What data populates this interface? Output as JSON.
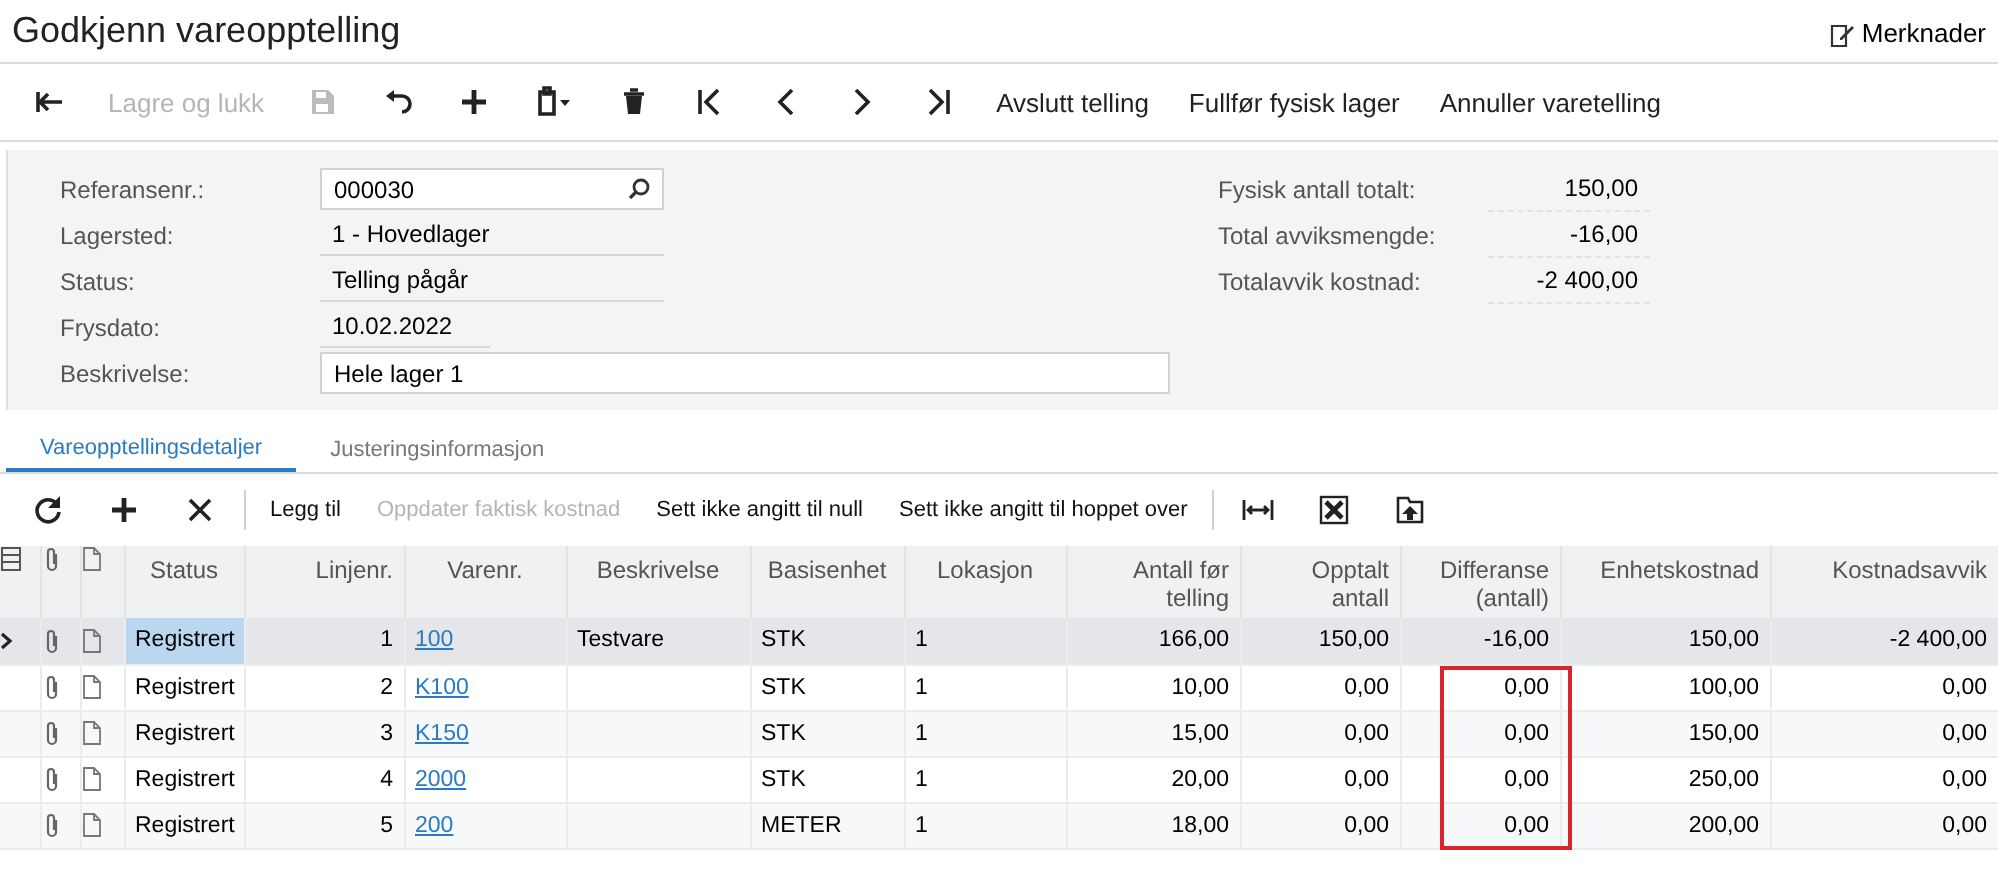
{
  "window": {
    "title": "Godkjenn vareopptelling",
    "notes_button": "Merknader"
  },
  "toolbar": [
    {
      "kind": "icon",
      "disabled": false
    },
    {
      "kind": "text",
      "label": "Lagre og lukk",
      "disabled": true
    },
    {
      "kind": "icon",
      "disabled": true
    },
    {
      "kind": "icon",
      "disabled": false
    },
    {
      "kind": "icon",
      "disabled": false
    },
    {
      "kind": "icon",
      "disabled": false
    },
    {
      "kind": "icon",
      "disabled": false
    },
    {
      "kind": "icon",
      "disabled": false
    },
    {
      "kind": "icon",
      "disabled": false
    },
    {
      "kind": "icon",
      "disabled": false
    },
    {
      "kind": "icon",
      "disabled": false
    },
    {
      "kind": "text",
      "label": "Avslutt telling",
      "disabled": false
    },
    {
      "kind": "text",
      "label": "Fullfør fysisk lager",
      "disabled": false
    },
    {
      "kind": "text",
      "label": "Annuller varetelling",
      "disabled": false
    }
  ],
  "form": {
    "left": [
      {
        "label": "Referansenr.:",
        "value": "000030",
        "kind": "lookup"
      },
      {
        "label": "Lagersted:",
        "value": "1 - Hovedlager",
        "kind": "readonly"
      },
      {
        "label": "Status:",
        "value": "Telling pågår",
        "kind": "readonly"
      },
      {
        "label": "Frysdato:",
        "value": "10.02.2022",
        "kind": "date"
      },
      {
        "label": "Beskrivelse:",
        "value": "Hele lager 1",
        "kind": "wide"
      }
    ],
    "right": [
      {
        "label": "Fysisk antall totalt:",
        "value": "150,00"
      },
      {
        "label": "Total avviksmengde:",
        "value": "-16,00"
      },
      {
        "label": "Totalavvik kostnad:",
        "value": "-2 400,00"
      }
    ]
  },
  "tabs": [
    {
      "label": "Vareopptellingsdetaljer",
      "selected": true
    },
    {
      "label": "Justeringsinformasjon",
      "selected": false
    }
  ],
  "grid_toolbar": [
    {
      "kind": "icon",
      "disabled": false
    },
    {
      "kind": "icon",
      "disabled": false
    },
    {
      "kind": "icon",
      "disabled": false
    },
    {
      "kind": "separator"
    },
    {
      "kind": "text",
      "label": "Legg til",
      "disabled": false
    },
    {
      "kind": "text",
      "label": "Oppdater faktisk kostnad",
      "disabled": true
    },
    {
      "kind": "text",
      "label": "Sett ikke angitt til null",
      "disabled": false
    },
    {
      "kind": "text",
      "label": "Sett ikke angitt til hoppet over",
      "disabled": false
    },
    {
      "kind": "separator"
    },
    {
      "kind": "icon",
      "disabled": false
    },
    {
      "kind": "icon",
      "disabled": false
    },
    {
      "kind": "icon",
      "disabled": false
    }
  ],
  "table": {
    "columns": [
      "Status",
      "Linjenr.",
      "Varenr.",
      "Beskrivelse",
      "Basisenhet",
      "Lokasjon",
      "Antall før telling",
      "Opptalt antall",
      "Differanse (antall)",
      "Enhetskostnad",
      "Kostnadsavvik"
    ],
    "rows": [
      {
        "selected": true,
        "difference_marked": false,
        "status": "Registrert",
        "line_no": "1",
        "item_no": "100",
        "description": "Testvare",
        "base_unit": "STK",
        "location": "1",
        "qty_before": "166,00",
        "counted": "150,00",
        "difference": "-16,00",
        "unit_cost": "150,00",
        "cost_variance": "-2 400,00"
      },
      {
        "selected": false,
        "difference_marked": true,
        "status": "Registrert",
        "line_no": "2",
        "item_no": "K100",
        "base_unit": "STK",
        "location": "1",
        "qty_before": "10,00",
        "counted": "0,00",
        "difference": "0,00",
        "unit_cost": "100,00",
        "cost_variance": "0,00"
      },
      {
        "selected": false,
        "difference_marked": true,
        "status": "Registrert",
        "line_no": "3",
        "item_no": "K150",
        "base_unit": "STK",
        "location": "1",
        "qty_before": "15,00",
        "counted": "0,00",
        "difference": "0,00",
        "unit_cost": "150,00",
        "cost_variance": "0,00"
      },
      {
        "selected": false,
        "difference_marked": true,
        "status": "Registrert",
        "line_no": "4",
        "item_no": "2000",
        "base_unit": "STK",
        "location": "1",
        "qty_before": "20,00",
        "counted": "0,00",
        "difference": "0,00",
        "unit_cost": "250,00",
        "cost_variance": "0,00"
      },
      {
        "selected": false,
        "difference_marked": true,
        "status": "Registrert",
        "line_no": "5",
        "item_no": "200",
        "base_unit": "METER",
        "location": "1",
        "qty_before": "18,00",
        "counted": "0,00",
        "difference": "0,00",
        "unit_cost": "200,00",
        "cost_variance": "0,00"
      }
    ]
  }
}
